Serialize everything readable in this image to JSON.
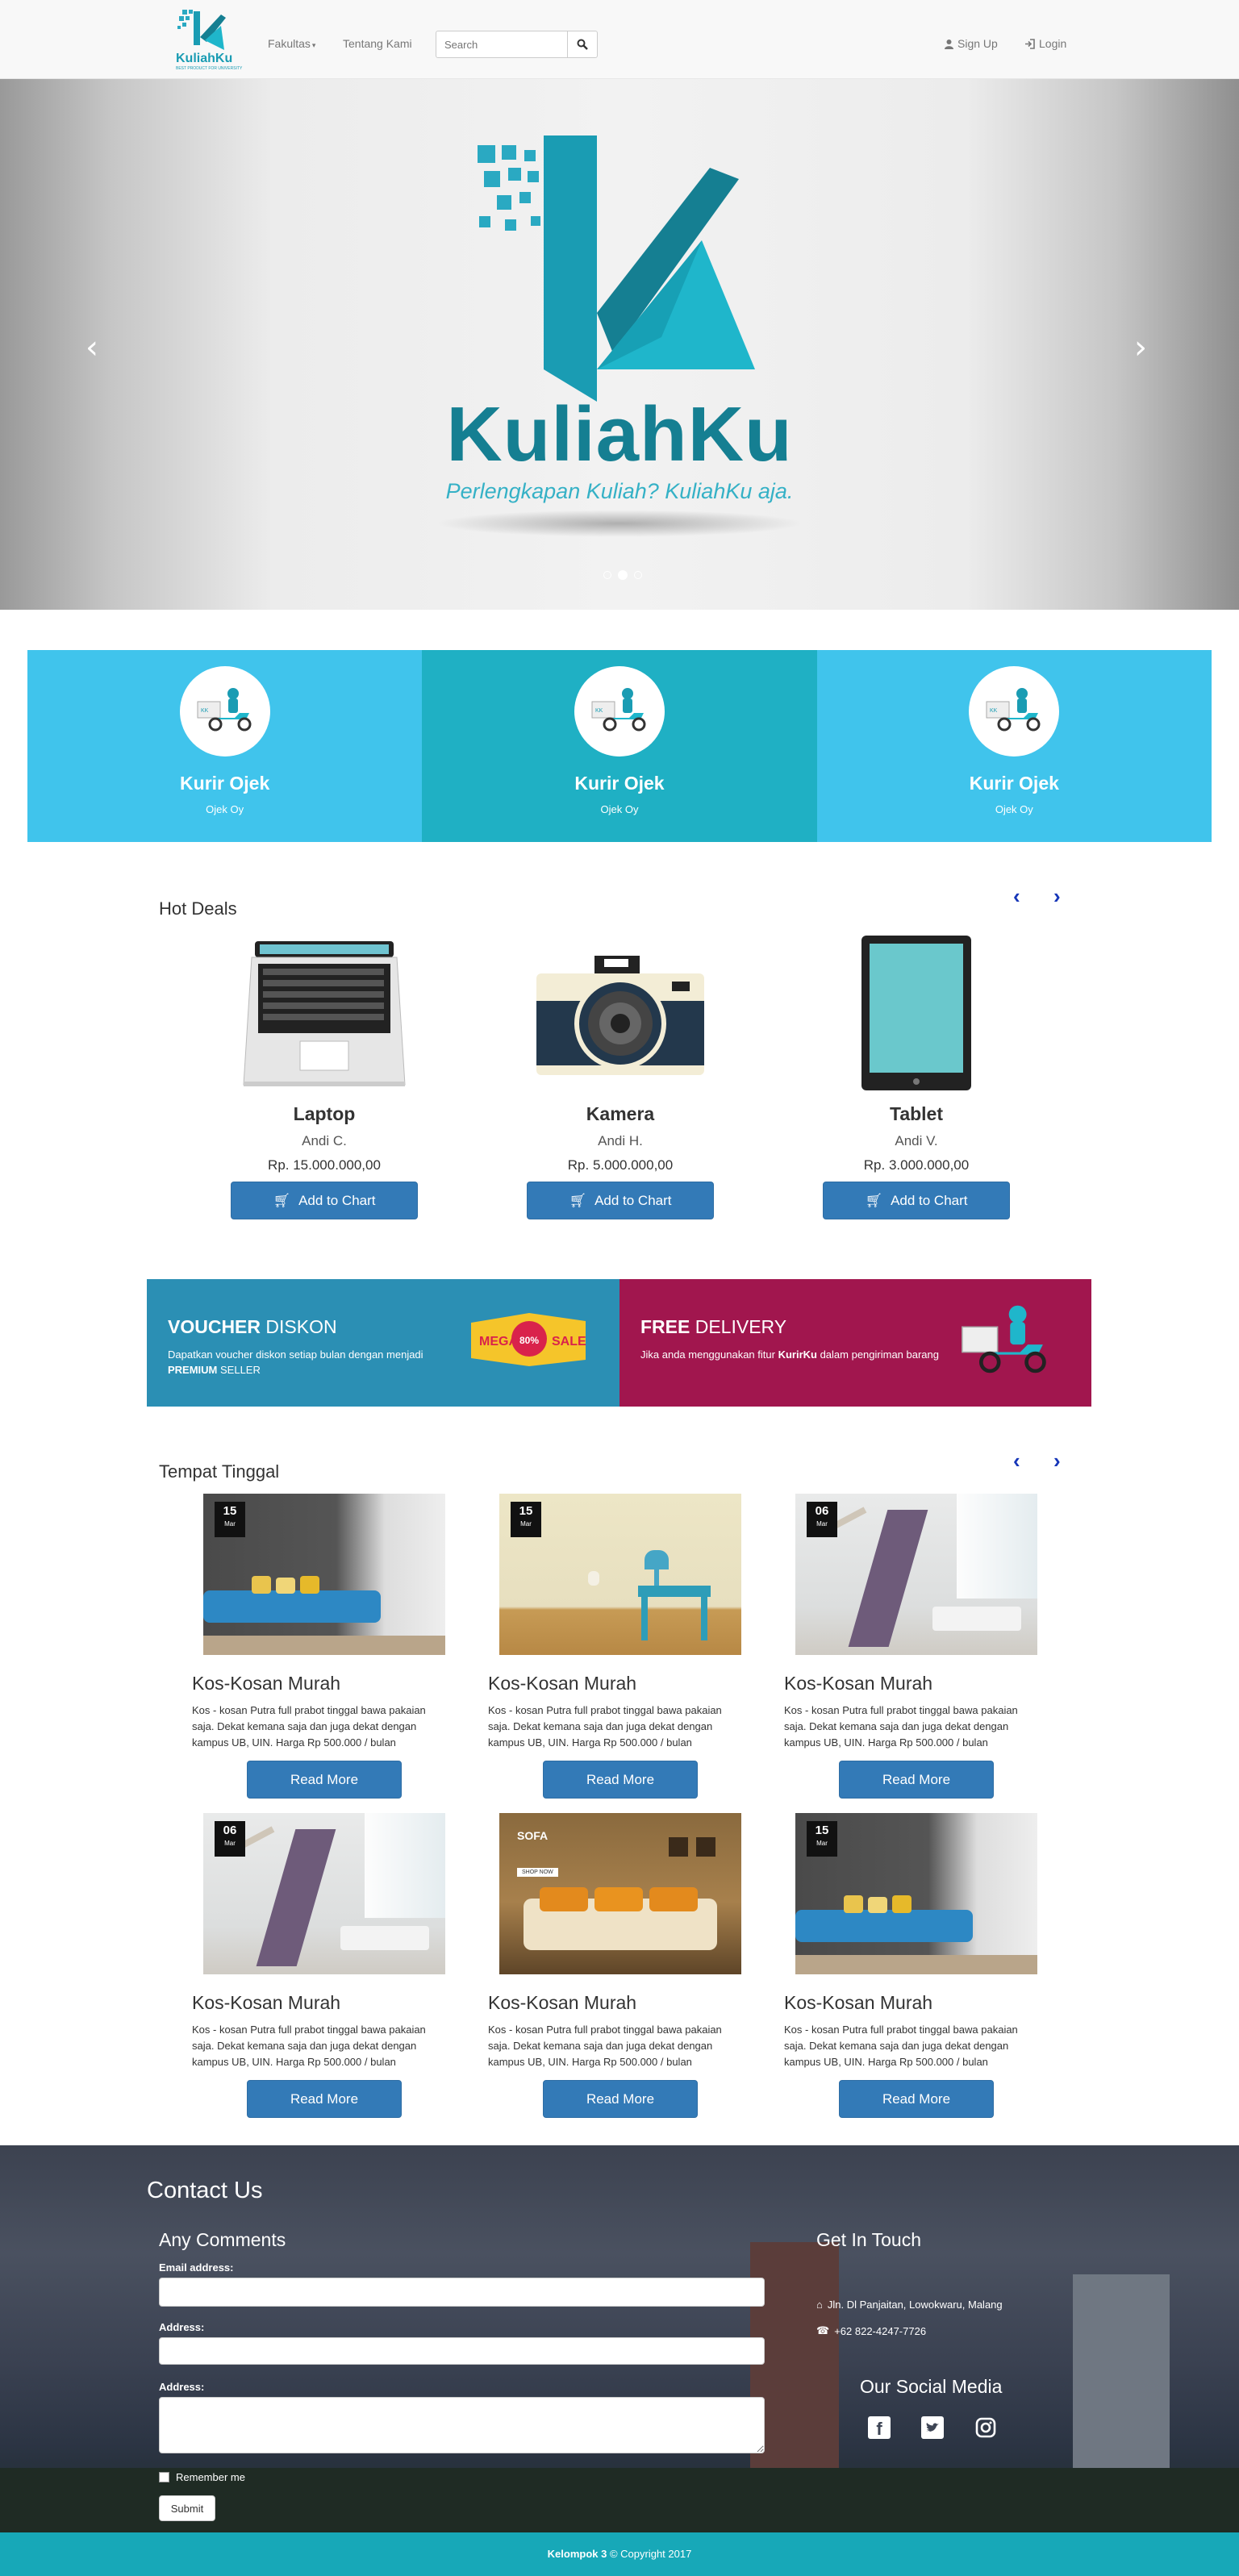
{
  "navbar": {
    "brand": "KuliahKu",
    "brand_tagline": "BEST PRODUCT FOR UNIVERSITY",
    "menu_fakultas": "Fakultas",
    "menu_tentang": "Tentang Kami",
    "search_placeholder": "Search",
    "signup": "Sign Up",
    "login": "Login"
  },
  "carousel": {
    "brand": "KuliahKu",
    "tagline": "Perlengkapan Kuliah? KuliahKu aja.",
    "slides_count": 3,
    "active_slide": 2,
    "prev_icon": "chevron-left-icon",
    "next_icon": "chevron-right-icon"
  },
  "couriers": [
    {
      "title": "Kurir Ojek",
      "subtitle": "Ojek Oy",
      "icon": "scooter-courier-icon"
    },
    {
      "title": "Kurir Ojek",
      "subtitle": "Ojek Oy",
      "icon": "scooter-courier-icon"
    },
    {
      "title": "Kurir Ojek",
      "subtitle": "Ojek Oy",
      "icon": "scooter-courier-icon"
    }
  ],
  "hot_deals": {
    "title": "Hot Deals",
    "prev": "‹",
    "next": "›",
    "button_label": "Add to Chart",
    "items": [
      {
        "name": "Laptop",
        "owner": "Andi C.",
        "price": "Rp. 15.000.000,00",
        "icon": "laptop-icon"
      },
      {
        "name": "Kamera",
        "owner": "Andi H.",
        "price": "Rp. 5.000.000,00",
        "icon": "camera-icon"
      },
      {
        "name": "Tablet",
        "owner": "Andi V.",
        "price": "Rp. 3.000.000,00",
        "icon": "tablet-icon"
      }
    ]
  },
  "promos": {
    "voucher": {
      "title_bold": "VOUCHER",
      "title_rest": " DISKON",
      "desc_a": "Dapatkan voucher diskon setiap bulan dengan menjadi ",
      "desc_b": "PREMIUM",
      "desc_c": " SELLER",
      "badge_left": "MEGA",
      "badge_mid": "80%",
      "badge_right": "SALE"
    },
    "delivery": {
      "title_bold": "FREE",
      "title_rest": " DELIVERY",
      "desc_a": "Jika anda menggunakan fitur ",
      "desc_b": "KurirKu",
      "desc_c": " dalam pengiriman barang"
    }
  },
  "tempat": {
    "title": "Tempat Tinggal",
    "prev": "‹",
    "next": "›",
    "button_label": "Read More",
    "items": [
      {
        "date": "15",
        "month": "Mar",
        "title": "Kos-Kosan Murah",
        "desc": "Kos - kosan Putra full prabot tinggal bawa pakaian saja. Dekat kemana saja dan juga dekat dengan kampus UB, UIN. Harga Rp 500.000 / bulan",
        "scene": "blue-sofa"
      },
      {
        "date": "15",
        "month": "Mar",
        "title": "Kos-Kosan Murah",
        "desc": "Kos - kosan Putra full prabot tinggal bawa pakaian saja. Dekat kemana saja dan juga dekat dengan kampus UB, UIN. Harga Rp 500.000 / bulan",
        "scene": "side-table"
      },
      {
        "date": "06",
        "month": "Mar",
        "title": "Kos-Kosan Murah",
        "desc": "Kos - kosan Putra full prabot tinggal bawa pakaian saja. Dekat kemana saja dan juga dekat dengan kampus UB, UIN. Harga Rp 500.000 / bulan",
        "scene": "staircase"
      },
      {
        "date": "06",
        "month": "Mar",
        "title": "Kos-Kosan Murah",
        "desc": "Kos - kosan Putra full prabot tinggal bawa pakaian saja. Dekat kemana saja dan juga dekat dengan kampus UB, UIN. Harga Rp 500.000 / bulan",
        "scene": "staircase"
      },
      {
        "date": "",
        "month": "",
        "title": "Kos-Kosan Murah",
        "desc": "Kos - kosan Putra full prabot tinggal bawa pakaian saja. Dekat kemana saja dan juga dekat dengan kampus UB, UIN. Harga Rp 500.000 / bulan",
        "scene": "orange-sofa",
        "banner_title": "SOFA",
        "banner_button": "SHOP NOW"
      },
      {
        "date": "15",
        "month": "Mar",
        "title": "Kos-Kosan Murah",
        "desc": "Kos - kosan Putra full prabot tinggal bawa pakaian saja. Dekat kemana saja dan juga dekat dengan kampus UB, UIN. Harga Rp 500.000 / bulan",
        "scene": "blue-sofa"
      }
    ]
  },
  "contact": {
    "title": "Contact Us",
    "comments_title": "Any Comments",
    "email_label": "Email address:",
    "address_label": "Address:",
    "address2_label": "Address:",
    "remember": "Remember me",
    "submit": "Submit",
    "touch_title": "Get In Touch",
    "address": "Jln. Dl Panjaitan, Lowokwaru, Malang",
    "phone": "+62 822-4247-7726",
    "social_title": "Our Social Media",
    "social": [
      "facebook-icon",
      "twitter-icon",
      "instagram-icon"
    ]
  },
  "footer": {
    "group": "Kelompok 3",
    "copyright": " © Copyright 2017"
  },
  "colors": {
    "brand_teal": "#1a9cb3",
    "courier_blue": "#40c4ec",
    "courier_mid": "#1fb0c4",
    "primary": "#337ab7",
    "voucher_bg": "#2b8fb4",
    "delivery_bg": "#a1164e",
    "footer_bar": "#17a8b8"
  }
}
